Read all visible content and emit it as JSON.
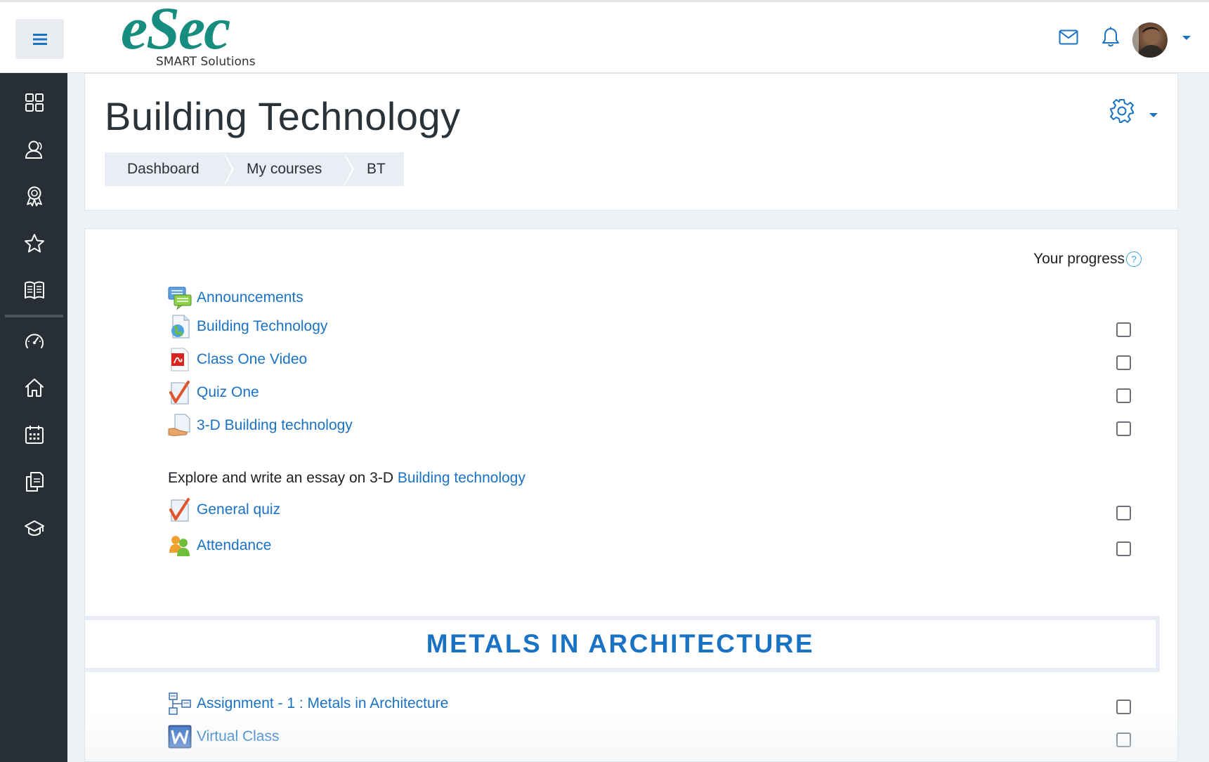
{
  "logo": {
    "main": "eSec",
    "sub": "SMART Solutions"
  },
  "colors": {
    "accent": "#1a72c4",
    "sidebar": "#282e35",
    "logo": "#168d7f"
  },
  "navbar": {
    "icons": [
      "menu-icon",
      "mail-icon",
      "bell-icon"
    ],
    "user_menu_caret": "chevron-down-icon"
  },
  "sidebar": {
    "items": [
      {
        "icon": "dashboard-grid-icon"
      },
      {
        "icon": "users-icon"
      },
      {
        "icon": "badge-icon"
      },
      {
        "icon": "star-icon"
      },
      {
        "icon": "book-icon"
      },
      {
        "icon": "speedometer-icon"
      },
      {
        "icon": "home-icon"
      },
      {
        "icon": "calendar-icon"
      },
      {
        "icon": "files-icon"
      },
      {
        "icon": "graduation-cap-icon"
      }
    ]
  },
  "header": {
    "title": "Building Technology",
    "breadcrumb": [
      "Dashboard",
      "My courses",
      "BT"
    ]
  },
  "content": {
    "progress_label": "Your progress",
    "help_glyph": "?",
    "activities": [
      {
        "label": "Announcements",
        "icon": "forum-icon",
        "checkbox": false
      },
      {
        "label": "Building Technology",
        "icon": "url-icon",
        "checkbox": true
      },
      {
        "label": "Class One Video",
        "icon": "pdf-icon",
        "checkbox": true
      },
      {
        "label": "Quiz One",
        "icon": "quiz-icon",
        "checkbox": true
      },
      {
        "label": "3-D Building technology",
        "icon": "assignment-icon",
        "checkbox": true
      },
      {
        "label": "General quiz",
        "icon": "quiz-icon",
        "checkbox": true
      },
      {
        "label": "Attendance",
        "icon": "attendance-icon",
        "checkbox": true
      }
    ],
    "description": {
      "text": "Explore and write an essay on 3-D ",
      "link": "Building technology"
    },
    "section": {
      "title": "METALS IN ARCHITECTURE",
      "activities": [
        {
          "label": "Assignment - 1 : Metals in Architecture",
          "icon": "workshop-icon",
          "checkbox": true
        },
        {
          "label": "Virtual Class",
          "icon": "word-doc-icon",
          "checkbox": true
        }
      ]
    }
  }
}
